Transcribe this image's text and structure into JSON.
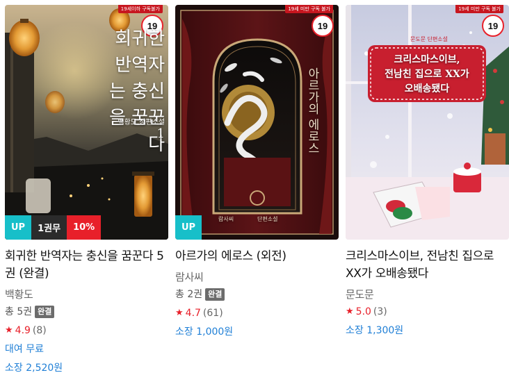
{
  "books": [
    {
      "cover_title": "회귀한 반역자는 충신을 꿈꾼다",
      "cover_author": "백황도 장편소설",
      "cover_volume": "1",
      "age_tab": "19세이하 구독불가",
      "age": "19",
      "badges": {
        "up": "UP",
        "free": "1권무",
        "sale": "10%"
      },
      "title": "회귀한 반역자는 충신을 꿈꾼다 5권 (완결)",
      "author": "백황도",
      "volumes": "총 5권",
      "complete": "완결",
      "rating": "4.9",
      "rating_count": "(8)",
      "rent": "대여 무료",
      "own": "소장 2,520원"
    },
    {
      "cover_title": "아르가의 에로스",
      "cover_author": "람사씨",
      "cover_series": "단편소설",
      "age_tab": "19세 미만 구독 불가",
      "age": "19",
      "badges": {
        "up": "UP"
      },
      "title": "아르가의 에로스 (외전)",
      "author": "람사씨",
      "volumes": "총 2권",
      "complete": "완결",
      "rating": "4.7",
      "rating_count": "(61)",
      "own": "소장 1,000원"
    },
    {
      "cover_title_line1": "크리스마스이브,",
      "cover_title_line2": "전남친 집으로 XX가",
      "cover_title_line3": "오배송됐다",
      "cover_series": "문도문 단편소설",
      "age_tab": "19세 미만 구독 불가",
      "age": "19",
      "title": "크리스마스이브, 전남친 집으로 XX가 오배송됐다",
      "author": "문도문",
      "rating": "5.0",
      "rating_count": "(3)",
      "own": "소장 1,300원"
    }
  ],
  "colors": {
    "accent_red": "#e8202a",
    "up_teal": "#17bfc9",
    "price_blue": "#1f7fd6"
  },
  "icons": {
    "rating": "star-icon"
  }
}
